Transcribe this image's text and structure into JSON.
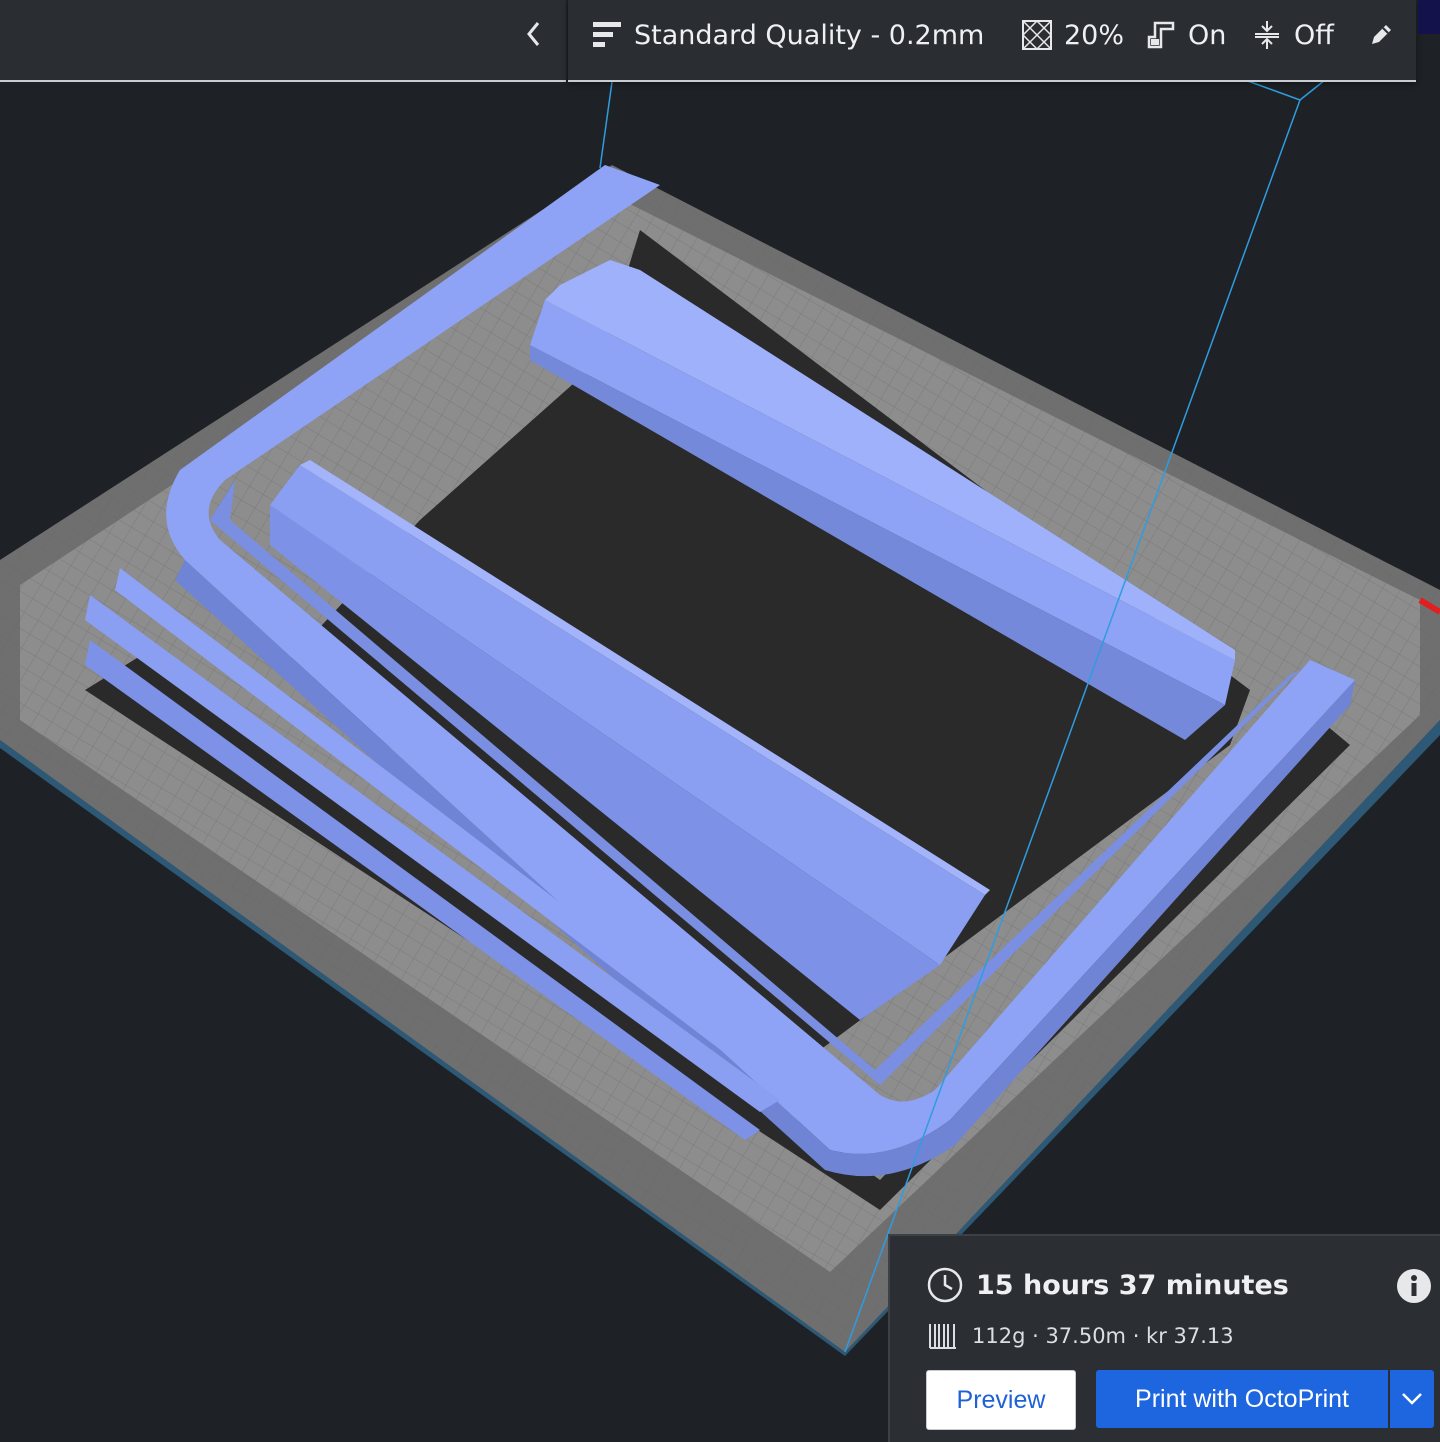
{
  "header": {
    "collapse_icon": "chevron-left-icon",
    "profile_icon": "print-profile-icon",
    "profile_label": "Standard Quality - 0.2mm",
    "infill_icon": "infill-icon",
    "infill_value": "20%",
    "support_icon": "support-icon",
    "support_value": "On",
    "adhesion_icon": "adhesion-icon",
    "adhesion_value": "Off",
    "edit_icon": "pencil-icon"
  },
  "job": {
    "clock_icon": "clock-icon",
    "time": "15 hours 37 minutes",
    "info_icon": "info-icon",
    "spool_icon": "filament-icon",
    "material": "112g · 37.50m · kr 37.13",
    "preview_label": "Preview",
    "print_label": "Print with OctoPrint",
    "dropdown_icon": "chevron-down-icon"
  },
  "colors": {
    "background": "#1e2226",
    "model": "#8a9ff2",
    "build_plate": "#8c8c8c",
    "accent_blue": "#1d66e0"
  }
}
